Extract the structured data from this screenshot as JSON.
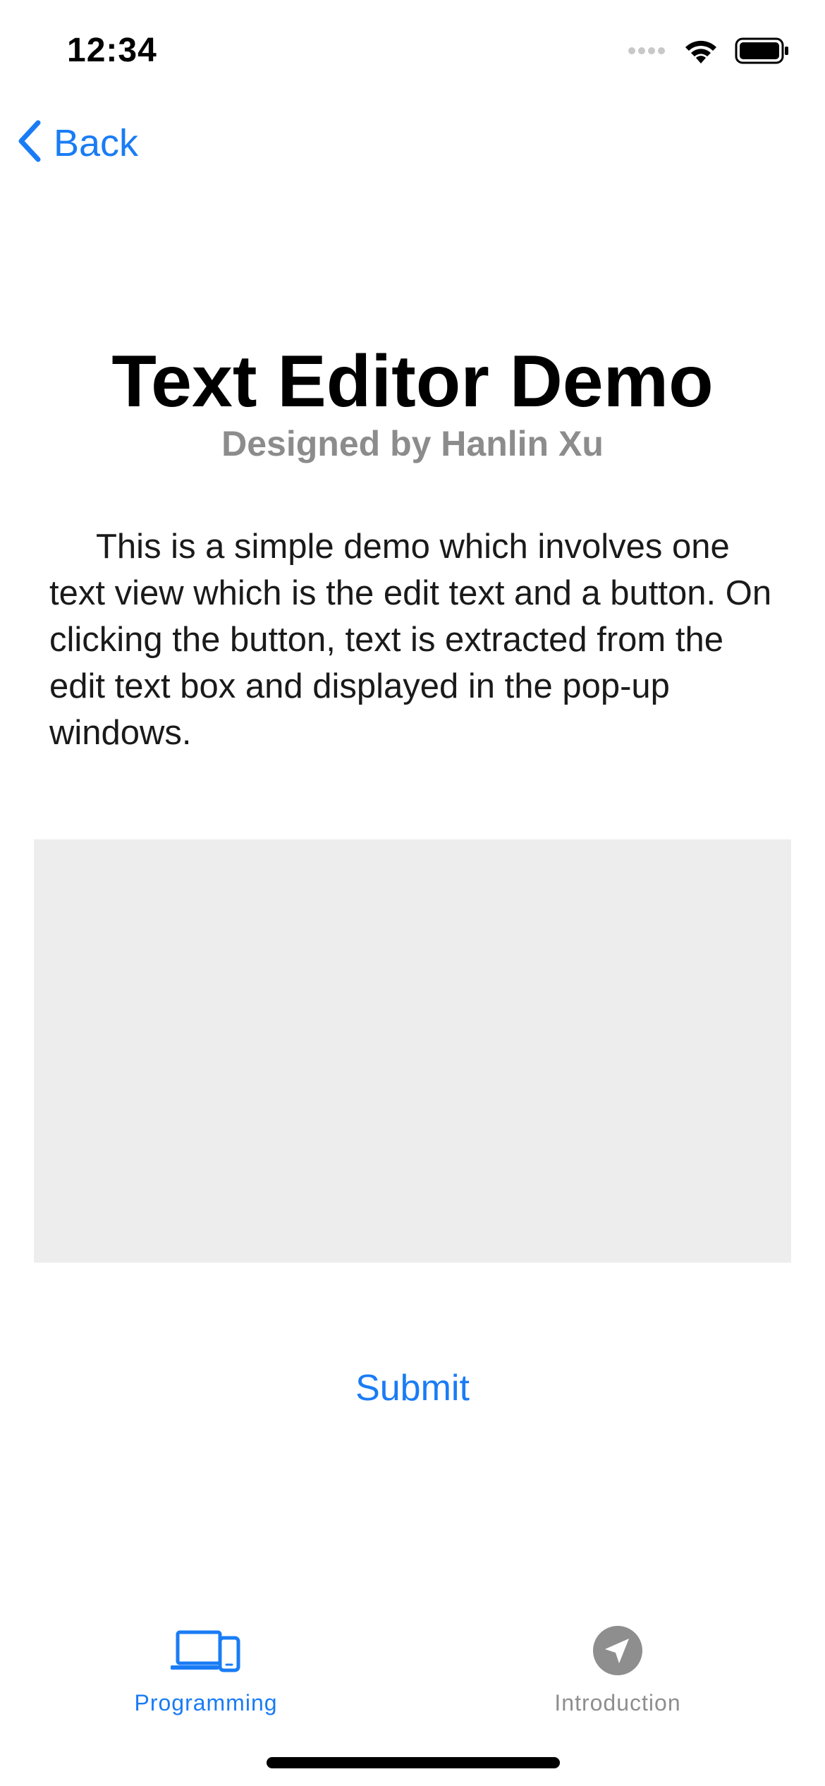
{
  "status_bar": {
    "time": "12:34"
  },
  "nav": {
    "back_label": "Back"
  },
  "header": {
    "title": "Text Editor Demo",
    "subtitle": "Designed by Hanlin Xu"
  },
  "main": {
    "description": "This is a simple demo which involves one text view which is the edit text and a button. On clicking the button, text is extracted from the edit text box and displayed in the pop-up windows.",
    "editor_value": "",
    "submit_label": "Submit"
  },
  "tab_bar": {
    "tabs": [
      {
        "label": "Programming",
        "icon": "laptop-phone-icon",
        "active": true
      },
      {
        "label": "Introduction",
        "icon": "paper-plane-icon",
        "active": false
      }
    ]
  },
  "colors": {
    "accent": "#1a7cf5",
    "inactive": "#8e8e8e",
    "subtitle": "#8c8c8c",
    "editor_background": "#ededed"
  }
}
